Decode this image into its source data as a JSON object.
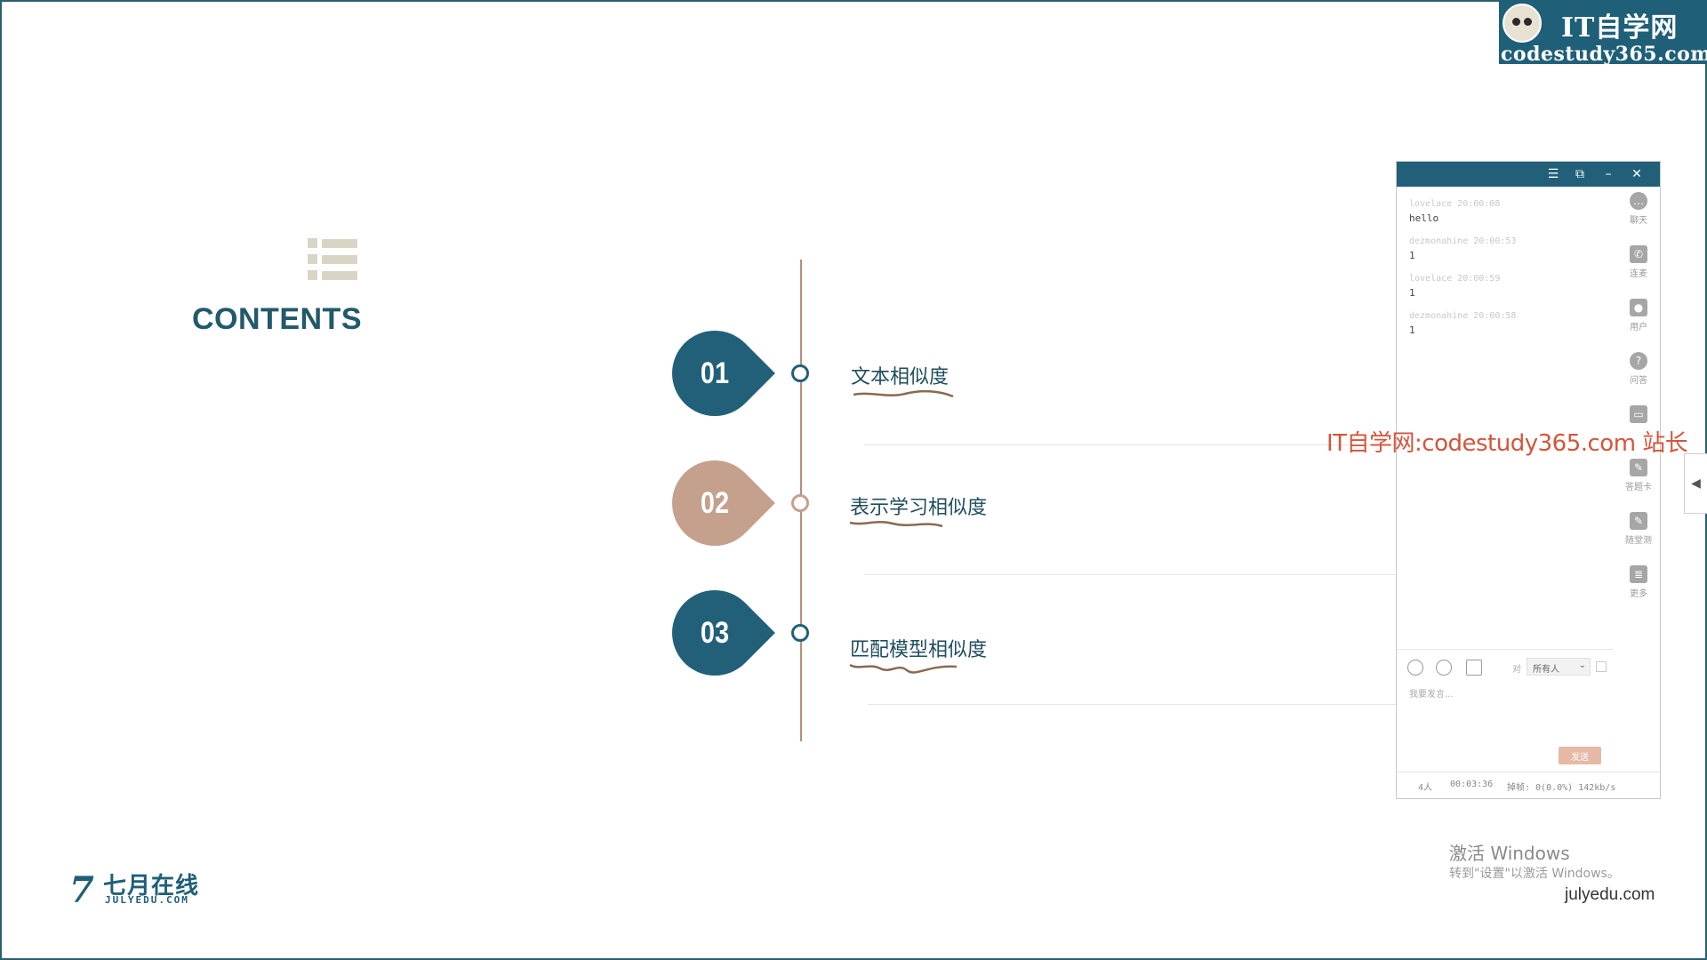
{
  "watermark_top": {
    "title": "IT自学网",
    "subtitle": "codestudy365.com"
  },
  "slide": {
    "contents_title": "CONTENTS",
    "items": [
      {
        "num": "01",
        "label": "文本相似度"
      },
      {
        "num": "02",
        "label": "表示学习相似度"
      },
      {
        "num": "03",
        "label": "匹配模型相似度"
      }
    ],
    "colors": {
      "teal": "#22607a",
      "tan": "#c4a08d",
      "line": "#b58e78",
      "underline": "#8a6a52"
    }
  },
  "chat_panel": {
    "titlebar_buttons": {
      "menu": "☰",
      "restore": "⧉",
      "minimize": "–",
      "close": "✕"
    },
    "messages": [
      {
        "head": "lovelace 20:00:08",
        "body": "hello"
      },
      {
        "head": "dezmonahine 20:00:53",
        "body": "1"
      },
      {
        "head": "lovelace 20:00:59",
        "body": "1"
      },
      {
        "head": "dezmonahine 20:00:58",
        "body": "1"
      }
    ],
    "tools": [
      {
        "icon": "chat-icon",
        "label": "聊天"
      },
      {
        "icon": "phone-icon",
        "label": "连麦"
      },
      {
        "icon": "user-icon",
        "label": "用户"
      },
      {
        "icon": "question-icon",
        "label": "问答"
      },
      {
        "icon": "screen-icon",
        "label": ""
      },
      {
        "icon": "answer-card-icon",
        "label": "答题卡"
      },
      {
        "icon": "quiz-icon",
        "label": "随堂测"
      },
      {
        "icon": "more-icon",
        "label": "更多"
      }
    ],
    "to_label": "对",
    "to_select": "所有人",
    "input_placeholder": "我要发言...",
    "send_label": "发送",
    "status": {
      "people": "4人",
      "time": "00:03:36",
      "stats": "掉帧: 0(0.0%) 142kb/s"
    }
  },
  "watermark_mid": "IT自学网:codestudy365.com 站长",
  "activate": {
    "title": "激活 Windows",
    "subtitle": "转到\"设置\"以激活 Windows。"
  },
  "site_url": "julyedu.com",
  "logo": {
    "mark": "7",
    "cn": "七月在线",
    "en": "JULYEDU.COM"
  }
}
